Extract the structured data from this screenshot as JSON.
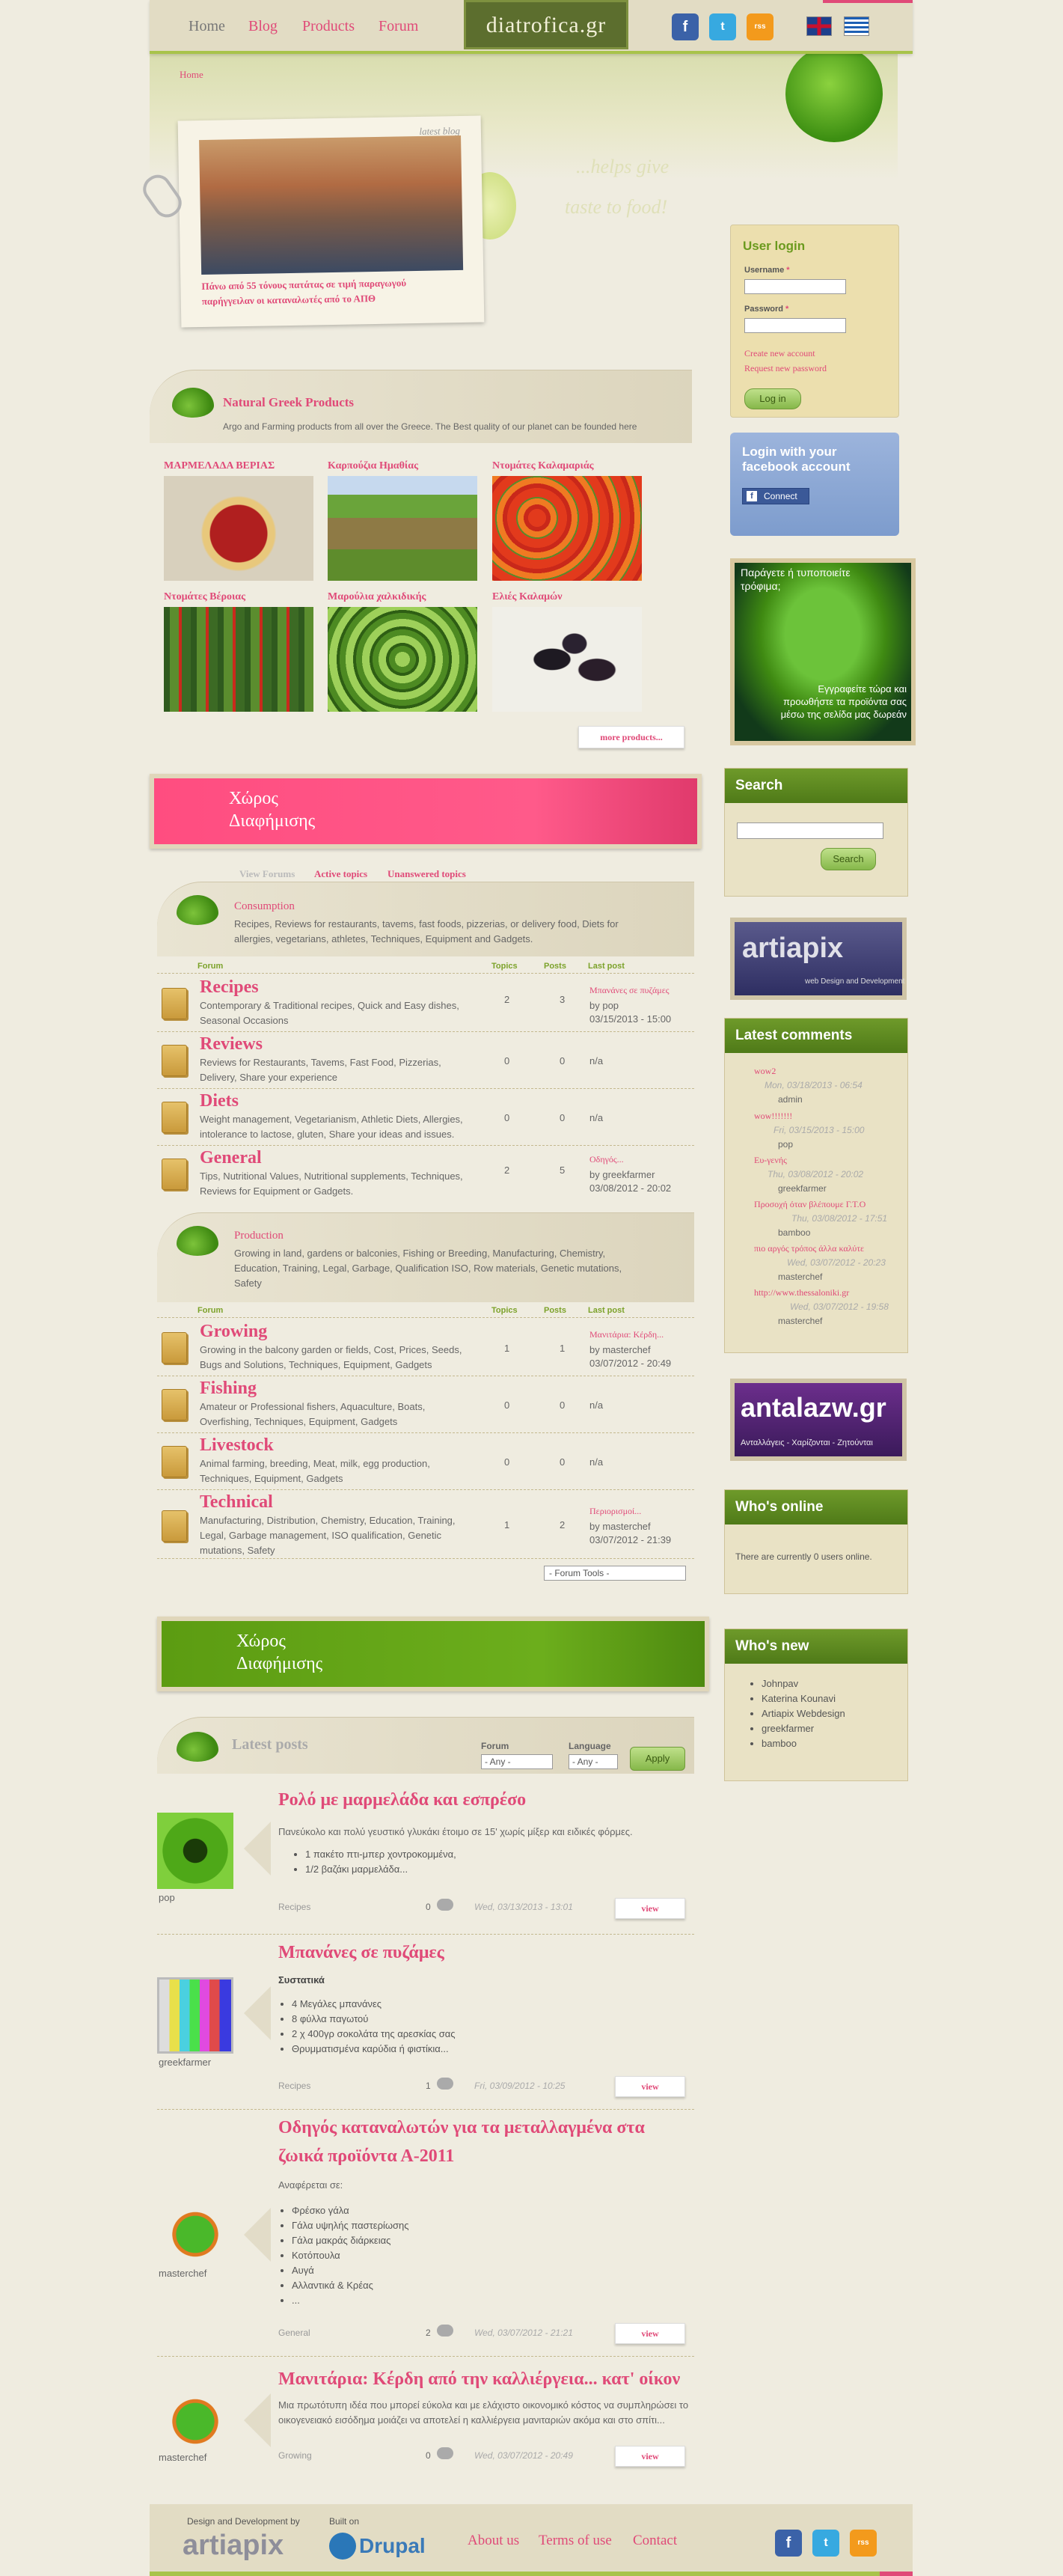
{
  "nav": {
    "home": "Home",
    "blog": "Blog",
    "products": "Products",
    "forum": "Forum"
  },
  "site": {
    "logo": "diatrofica.gr",
    "breadcrumb": "Home",
    "slogan1": "...helps give",
    "slogan2": "taste to food!"
  },
  "colors": {
    "accent_pink": "#e04a78",
    "accent_green": "#6b9a1e"
  },
  "social": {
    "facebook": "f",
    "twitter": "t",
    "rss": "rss"
  },
  "latest_blog": {
    "label": "latest blog",
    "title": "Πάνω από 55 τόνους πατάτας σε τιμή παραγωγού παρήγγειλαν οι καταναλωτές από το ΑΠΘ"
  },
  "products": {
    "title": "Natural Greek Products",
    "subtitle": "Argo and Farming products from all over the Greece. The Best quality of our planet can be founded here",
    "items": [
      "ΜΑΡΜΕΛΑΔΑ ΒΕΡΙΑΣ",
      "Καρπούζια Ημαθίας",
      "Ντομάτες Καλαμαριάς",
      "Ντομάτες Βέροιας",
      "Μαρούλια χαλκιδικής",
      "Ελιές Καλαμών"
    ],
    "more": "more products..."
  },
  "ad": {
    "line1": "Χώρος",
    "line2": "Διαφήμισης"
  },
  "forum_tabs": {
    "view": "View Forums",
    "active": "Active topics",
    "unanswered": "Unanswered topics"
  },
  "forum_cols": {
    "forum": "Forum",
    "topics": "Topics",
    "posts": "Posts",
    "last": "Last post"
  },
  "containers": [
    {
      "title": "Consumption",
      "desc": "Recipes, Reviews for restaurants, tavems, fast foods, pizzerias, or delivery food, Diets for allergies, vegetarians, athletes, Techniques, Equipment and Gadgets.",
      "forums": [
        {
          "name": "Recipes",
          "desc": "Contemporary & Traditional recipes, Quick and Easy dishes, Seasonal Occasions",
          "topics": "2",
          "posts": "3",
          "last_title": "Μπανάνες σε πυζάμες",
          "last_by": "by pop",
          "last_date": "03/15/2013 - 15:00"
        },
        {
          "name": "Reviews",
          "desc": "Reviews for Restaurants, Tavems, Fast Food, Pizzerias, Delivery, Share your experience",
          "topics": "0",
          "posts": "0",
          "last_title": "",
          "last_by": "n/a",
          "last_date": ""
        },
        {
          "name": "Diets",
          "desc": "Weight management, Vegetarianism, Athletic Diets, Allergies, intolerance to lactose, gluten, Share your ideas and issues.",
          "topics": "0",
          "posts": "0",
          "last_title": "",
          "last_by": "n/a",
          "last_date": ""
        },
        {
          "name": "General",
          "desc": "Tips, Nutritional Values, Nutritional supplements, Techniques, Reviews for Equipment or Gadgets.",
          "topics": "2",
          "posts": "5",
          "last_title": "Οδηγός...",
          "last_by": "by greekfarmer",
          "last_date": "03/08/2012 - 20:02"
        }
      ]
    },
    {
      "title": "Production",
      "desc": "Growing in land, gardens or balconies, Fishing or Breeding, Manufacturing, Chemistry, Education, Training, Legal, Garbage, Qualification ISO, Row materials, Genetic mutations, Safety",
      "forums": [
        {
          "name": "Growing",
          "desc": "Growing in the balcony garden or fields, Cost, Prices, Seeds, Bugs and Solutions, Techniques, Equipment, Gadgets",
          "topics": "1",
          "posts": "1",
          "last_title": "Μανιτάρια: Κέρδη...",
          "last_by": "by masterchef",
          "last_date": "03/07/2012 - 20:49"
        },
        {
          "name": "Fishing",
          "desc": "Amateur or Professional fishers, Aquaculture, Boats, Overfishing, Techniques, Equipment, Gadgets",
          "topics": "0",
          "posts": "0",
          "last_title": "",
          "last_by": "n/a",
          "last_date": ""
        },
        {
          "name": "Livestock",
          "desc": "Animal farming, breeding, Meat, milk, egg production, Techniques, Equipment, Gadgets",
          "topics": "0",
          "posts": "0",
          "last_title": "",
          "last_by": "n/a",
          "last_date": ""
        },
        {
          "name": "Technical",
          "desc": "Manufacturing, Distribution, Chemistry, Education, Training, Legal, Garbage management, ISO qualification, Genetic mutations, Safety",
          "topics": "1",
          "posts": "2",
          "last_title": "Περιορισμοί...",
          "last_by": "by masterchef",
          "last_date": "03/07/2012 - 21:39"
        }
      ]
    }
  ],
  "forum_tools": "- Forum Tools -",
  "latest_posts": {
    "title": "Latest posts",
    "forum_label": "Forum",
    "forum_value": "- Any -",
    "lang_label": "Language",
    "lang_value": "- Any -",
    "apply": "Apply"
  },
  "posts": [
    {
      "title": "Ρολό με μαρμελάδα και εσπρέσο",
      "intro": "Πανεύκολο και πολύ γευστικό γλυκάκι έτοιμο σε 15' χωρίς μίξερ και ειδικές φόρμες.",
      "heading": "",
      "items": [
        "1 πακέτο πτι-μπερ χοντροκομμένα,",
        "1/2 βαζάκι μαρμελάδα..."
      ],
      "author": "pop",
      "category": "Recipes",
      "comments": "0",
      "date": "Wed, 03/13/2013 - 13:01",
      "view": "view"
    },
    {
      "title": "Μπανάνες σε πυζάμες",
      "intro": "",
      "heading": "Συστατικά",
      "items": [
        "4 Μεγάλες μπανάνες",
        "8 φύλλα παγωτού",
        "2 χ 400γρ σοκολάτα της αρεσκίας σας",
        "Θρυμματισμένα καρύδια ή φιστίκια..."
      ],
      "author": "greekfarmer",
      "category": "Recipes",
      "comments": "1",
      "date": "Fri, 03/09/2012 - 10:25",
      "view": "view"
    },
    {
      "title": "Οδηγός καταναλωτών για τα μεταλλαγμένα στα ζωικά προϊόντα Α-2011",
      "intro": "Αναφέρεται σε:",
      "heading": "",
      "items": [
        "Φρέσκο γάλα",
        "Γάλα υψηλής παστερίωσης",
        "Γάλα μακράς διάρκειας",
        "Κοτόπουλα",
        "Αυγά",
        "Αλλαντικά & Κρέας",
        "..."
      ],
      "author": "masterchef",
      "category": "General",
      "comments": "2",
      "date": "Wed, 03/07/2012 - 21:21",
      "view": "view"
    },
    {
      "title": "Μανιτάρια: Κέρδη από την καλλιέργεια... κατ' οίκον",
      "intro": "Μια πρωτότυπη ιδέα που μπορεί εύκολα και με ελάχιστο οικονομικό κόστος να συμπληρώσει το οικογενειακό εισόδημα μοιάζει να αποτελεί η καλλιέργεια μανιταριών ακόμα και στο σπίτι...",
      "heading": "",
      "items": [],
      "author": "masterchef",
      "category": "Growing",
      "comments": "0",
      "date": "Wed, 03/07/2012 - 20:49",
      "view": "view"
    }
  ],
  "login": {
    "title": "User login",
    "username": "Username",
    "password": "Password",
    "req": "*",
    "create": "Create new account",
    "request": "Request new password",
    "button": "Log in"
  },
  "fb": {
    "title": "Login with your facebook account",
    "connect": "Connect"
  },
  "promo": {
    "top": "Παράγετε ή τυποποιείτε τρόφιμα;",
    "bottom": "Εγγραφείτε τώρα και προωθήστε τα προϊόντα σας μέσω της σελίδα μας δωρεάν"
  },
  "search": {
    "title": "Search",
    "button": "Search"
  },
  "artiapix": {
    "name": "artiapix",
    "tag": "web Design and Development"
  },
  "comments": {
    "title": "Latest comments",
    "items": [
      {
        "t": "wow2",
        "d": "Mon, 03/18/2013 - 06:54",
        "u": "admin"
      },
      {
        "t": "wow!!!!!!!",
        "d": "Fri, 03/15/2013 - 15:00",
        "u": "pop"
      },
      {
        "t": "Ευ-γενής",
        "d": "Thu, 03/08/2012 - 20:02",
        "u": "greekfarmer"
      },
      {
        "t": "Προσοχή όταν βλέπουμε Γ.Τ.Ο",
        "d": "Thu, 03/08/2012 - 17:51",
        "u": "bamboo"
      },
      {
        "t": "πιο αργός τρόπος άλλα καλύτε",
        "d": "Wed, 03/07/2012 - 20:23",
        "u": "masterchef"
      },
      {
        "t": "http://www.thessaloniki.gr",
        "d": "Wed, 03/07/2012 - 19:58",
        "u": "masterchef"
      }
    ]
  },
  "antalazw": {
    "name": "antalazw.gr",
    "tag": "Ανταλλάγεις - Χαρίζονται - Ζητούνται"
  },
  "online": {
    "title": "Who's online",
    "text": "There are currently 0 users online."
  },
  "whosnew": {
    "title": "Who's new",
    "users": [
      "Johnpav",
      "Katerina Kounavi",
      "Artiapix Webdesign",
      "greekfarmer",
      "bamboo"
    ]
  },
  "footer": {
    "design": "Design and Development by",
    "built": "Built on",
    "artiapix": "artiapix",
    "drupal": "Drupal",
    "about": "About us",
    "terms": "Terms of use",
    "contact": "Contact"
  }
}
